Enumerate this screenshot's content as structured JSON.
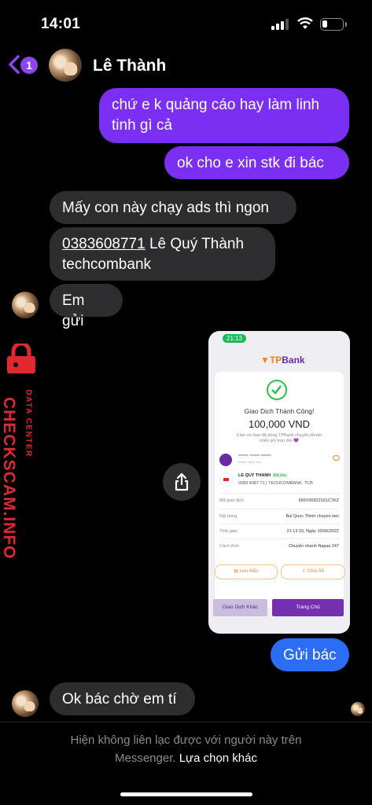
{
  "status_bar": {
    "time": "14:01"
  },
  "header": {
    "back_badge_count": "1",
    "contact_name": "Lê Thành"
  },
  "messages": {
    "m1": "chứ e k quảng cáo hay làm linh\ntinh gì cả",
    "m2": "ok cho e xin stk đi bác",
    "m3": "Mấy con này chạy ads thì ngon",
    "m4_account": "0383608771",
    "m4_rest": " Lê Quý Thành\ntechcombank",
    "m5": "Em gửi",
    "m6": "Gửi bác",
    "m7": "Ok bác chờ em tí"
  },
  "watermark": {
    "brand": "CHECKSCAM.INFO",
    "sub": "DATA CENTER"
  },
  "receipt": {
    "time": "21:13",
    "logo_tp": "TP",
    "logo_bank": "Bank",
    "success": "Giao Dịch Thành Công!",
    "amount": "100,000 VND",
    "thanks": "Cảm ơn bạn đã dùng TPBank chuyển khoản\nmiễn phí trọn đời 💜",
    "from_masked": "****** ****** ******",
    "from_masked2": "***** **** ***",
    "to_name": "LE QUY THANH",
    "to_tag": "Đã lưu",
    "to_account": "0383 6087 71 | TECHCOMBANK, TCB",
    "rows": [
      {
        "label": "Mã giao dịch",
        "value": "666V00922161C7KZ"
      },
      {
        "label": "Nội dung",
        "value": "Bui Quoc Thinh chuyen tien"
      },
      {
        "label": "Thời gian",
        "value": "21:13:15, Ngày 10/06/2022"
      },
      {
        "label": "Cách thức",
        "value": "Chuyển nhanh Napas 247"
      }
    ],
    "save_btn": "Lưu Mẫu",
    "share_btn": "Chia Sẻ",
    "btn_other": "Giao Dịch Khác",
    "btn_home": "Trang Chủ"
  },
  "footer": {
    "notice": "Hiện không liên lạc được với người này trên\nMessenger. ",
    "link": "Lựa chọn khác"
  },
  "colors": {
    "outgoing": "#7b2ff2",
    "incoming": "#2d2d2f",
    "blue": "#2b6ef5",
    "watermark": "#e0292f"
  }
}
